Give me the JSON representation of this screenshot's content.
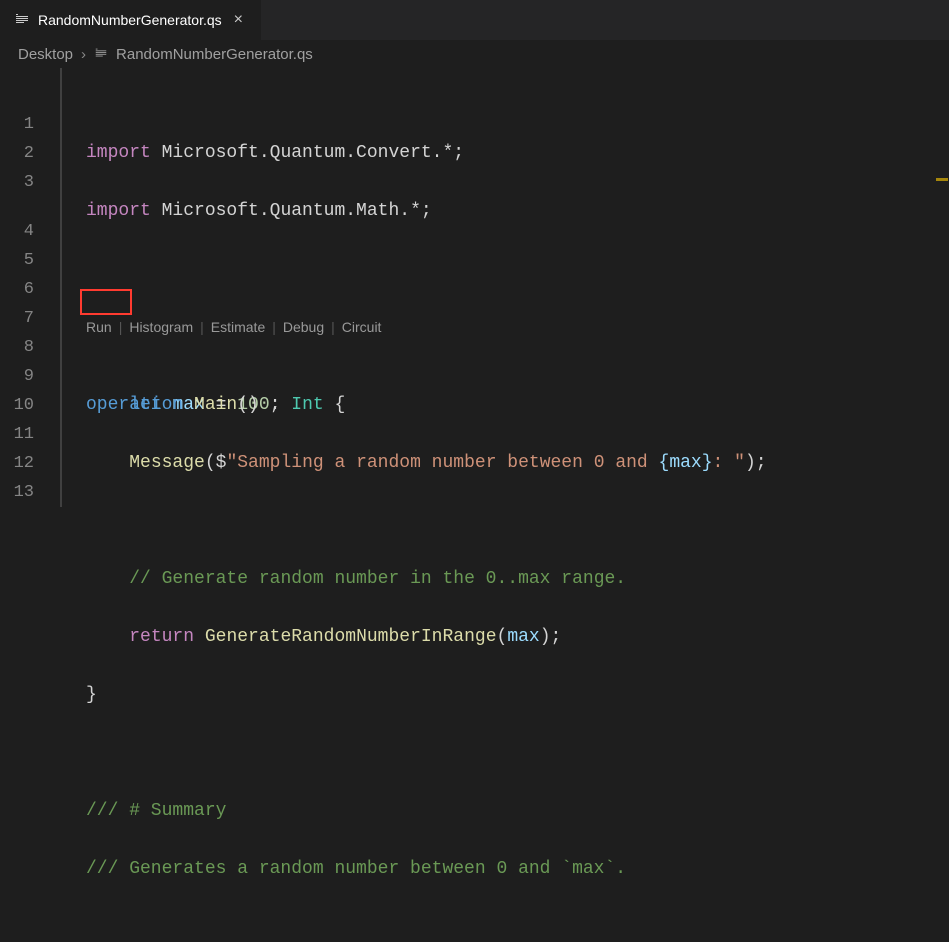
{
  "tab": {
    "filename": "RandomNumberGenerator.qs"
  },
  "breadcrumbs": {
    "folder": "Desktop",
    "file": "RandomNumberGenerator.qs"
  },
  "codelens": {
    "run": "Run",
    "histogram": "Histogram",
    "estimate": "Estimate",
    "debug": "Debug",
    "circuit": "Circuit"
  },
  "lineNumbers": [
    "1",
    "2",
    "3",
    "4",
    "5",
    "6",
    "7",
    "8",
    "9",
    "10",
    "11",
    "12",
    "13"
  ],
  "code": {
    "l1": {
      "kw": "import",
      "ns": "Microsoft.Quantum.Convert.*"
    },
    "l2": {
      "kw": "import",
      "ns": "Microsoft.Quantum.Math.*"
    },
    "l4": {
      "kw": "operation",
      "name": "Main",
      "ret": "Int"
    },
    "l5": {
      "kw": "let",
      "var": "max",
      "val": "100"
    },
    "l6": {
      "fn": "Message",
      "strA": "\"Sampling a random number between 0 and ",
      "interp": "{max}",
      "strB": ": \""
    },
    "l8": {
      "comment": "// Generate random number in the 0..max range."
    },
    "l9": {
      "kw": "return",
      "fn": "GenerateRandomNumberInRange",
      "arg": "max"
    },
    "l12": {
      "comment": "/// # Summary"
    },
    "l13": {
      "comment": "/// Generates a random number between 0 and `max`."
    }
  }
}
